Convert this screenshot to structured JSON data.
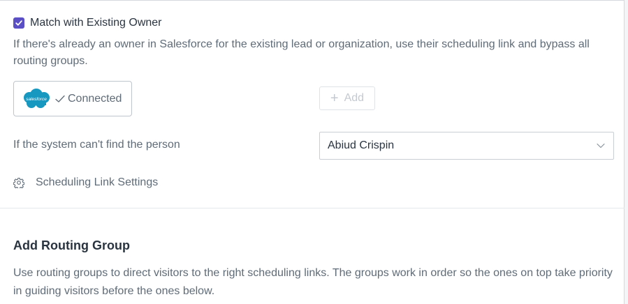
{
  "owner_match": {
    "checkbox_label": "Match with Existing Owner",
    "checked": true,
    "description": "If there's already an owner in Salesforce for the existing lead or organization, use their scheduling link and bypass all routing groups."
  },
  "integration": {
    "logo_text": "salesforce",
    "status": "Connected",
    "add_label": "Add"
  },
  "fallback": {
    "label": "If the system can't find the person",
    "selected": "Abiud Crispin"
  },
  "scheduling_link_settings": {
    "label": "Scheduling Link Settings"
  },
  "routing_group": {
    "title": "Add Routing Group",
    "description": "Use routing groups to direct visitors to the right scheduling links. The groups work in order so the ones on top take priority in guiding visitors before the ones below."
  },
  "colors": {
    "accent": "#5b4fc5",
    "salesforce_blue": "#1798c1"
  }
}
